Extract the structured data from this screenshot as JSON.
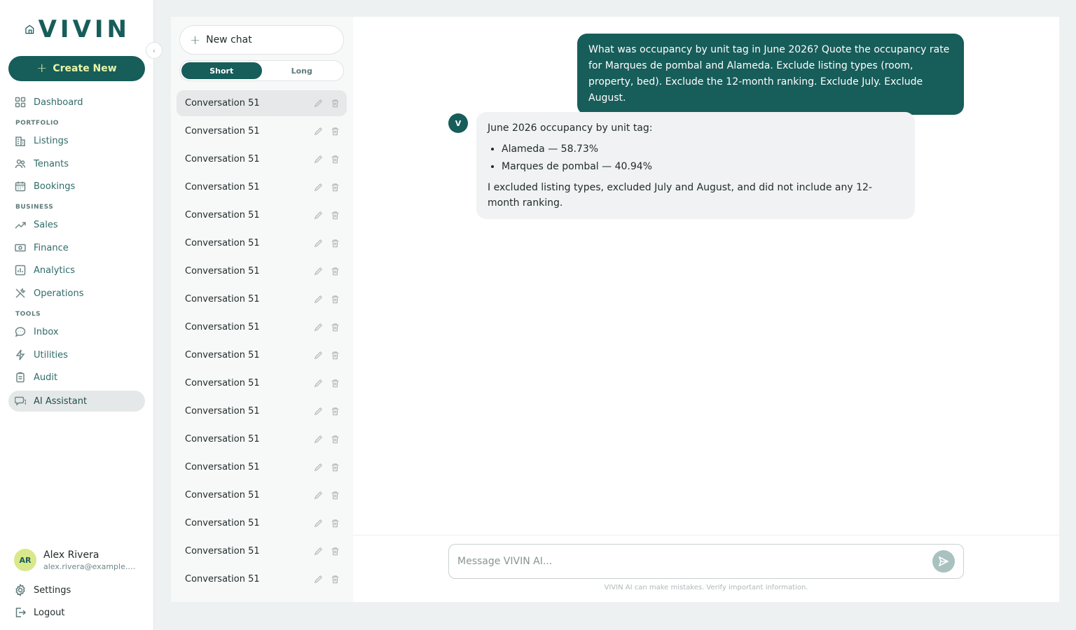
{
  "brand": {
    "name": "VIVIN",
    "accent": "#175d5a",
    "accent_light": "#e9f5a8"
  },
  "sidebar": {
    "collapse_icon": "chevron-left-icon",
    "create_label": "Create New",
    "items": [
      {
        "label": "Dashboard",
        "icon": "grid-icon"
      },
      {
        "label": "Listings",
        "icon": "building-icon"
      },
      {
        "label": "Tenants",
        "icon": "users-icon"
      },
      {
        "label": "Bookings",
        "icon": "calendar-icon"
      },
      {
        "label": "Sales",
        "icon": "trend-icon"
      },
      {
        "label": "Finance",
        "icon": "cash-icon"
      },
      {
        "label": "Analytics",
        "icon": "chart-icon"
      },
      {
        "label": "Operations",
        "icon": "tools-icon"
      },
      {
        "label": "Inbox",
        "icon": "chat-icon"
      },
      {
        "label": "Utilities",
        "icon": "bolt-icon"
      },
      {
        "label": "Audit",
        "icon": "clipboard-icon"
      },
      {
        "label": "AI Assistant",
        "icon": "ai-chat-icon"
      }
    ],
    "sections": {
      "portfolio": "PORTFOLIO",
      "business": "BUSINESS",
      "tools": "TOOLS"
    },
    "user": {
      "initials": "AR",
      "name": "Alex Rivera",
      "email": "alex.rivera@example.com"
    },
    "settings_label": "Settings",
    "logout_label": "Logout"
  },
  "conversations": {
    "new_chat_label": "New chat",
    "toggle": {
      "short": "Short",
      "long": "Long",
      "selected": "Short"
    },
    "items": [
      "Conversation 51",
      "Conversation 51",
      "Conversation 51",
      "Conversation 51",
      "Conversation 51",
      "Conversation 51",
      "Conversation 51",
      "Conversation 51",
      "Conversation 51",
      "Conversation 51",
      "Conversation 51",
      "Conversation 51",
      "Conversation 51",
      "Conversation 51",
      "Conversation 51",
      "Conversation 51",
      "Conversation 51",
      "Conversation 51"
    ]
  },
  "chat": {
    "user_message": "What was occupancy by unit tag in June 2026? Quote the occupancy rate for Marques de pombal and Alameda. Exclude listing types (room, property, bed). Exclude the 12-month ranking. Exclude July. Exclude August.",
    "bot_initial": "V",
    "bot_intro": "June 2026 occupancy by unit tag:",
    "bot_bullets": [
      "Alameda — 58.73%",
      "Marques de pombal — 40.94%"
    ],
    "bot_outro": "I excluded listing types, excluded July and August, and did not include any 12-month ranking.",
    "composer_placeholder": "Message VIVIN AI...",
    "disclaimer": "VIVIN AI can make mistakes. Verify important information."
  }
}
